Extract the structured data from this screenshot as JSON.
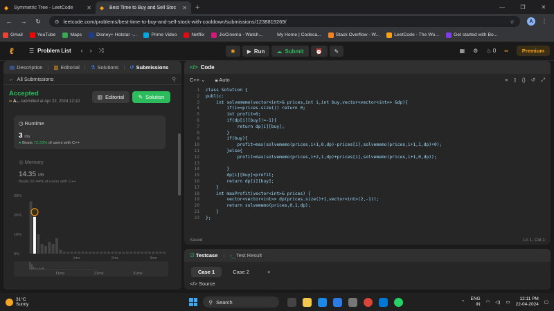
{
  "browser": {
    "tabs": [
      {
        "title": "Symmetric Tree - LeetCode",
        "active": false
      },
      {
        "title": "Best Time to Buy and Sell Stoc",
        "active": true
      }
    ],
    "url": "leetcode.com/problems/best-time-to-buy-and-sell-stock-with-cooldown/submissions/1238819269/",
    "profile_initial": "A",
    "bookmarks": [
      "Gmail",
      "YouTube",
      "Maps",
      "Disney+ Hotstar -...",
      "Prime Video",
      "Netflix",
      "JioCinema - Watch...",
      "My Home | Codeca...",
      "Stack Overflow - W...",
      "LeetCode - The Wo...",
      "Get started with Bo..."
    ]
  },
  "topbar": {
    "problem_list": "Problem List",
    "run": "Run",
    "submit": "Submit",
    "streak": "0",
    "premium": "Premium"
  },
  "left": {
    "tabs": [
      "Description",
      "Editorial",
      "Solutions",
      "Submissions"
    ],
    "all_submissions": "All Submissions",
    "status": "Accepted",
    "user": "A...",
    "submitted": "submitted at Apr 22, 2024 12:10",
    "editorial_btn": "Editorial",
    "solution_btn": "Solution",
    "runtime_label": "Runtime",
    "runtime_value": "3",
    "runtime_unit": "ms",
    "runtime_beats_pre": "Beats",
    "runtime_beats_pct": "72.33%",
    "runtime_beats_post": "of users with C++",
    "memory_label": "Memory",
    "memory_value": "14.35",
    "memory_unit": "MB",
    "memory_beats": "Beats 26.44% of users with C++"
  },
  "chart_data": {
    "type": "bar",
    "y_ticks": [
      "30%",
      "20%",
      "10%",
      "0%"
    ],
    "x_ticks": [
      "1ms",
      "2ms",
      "3ms"
    ],
    "mini_x_ticks": [
      "11ms",
      "21ms",
      "31ms"
    ],
    "ylim": [
      0,
      30
    ],
    "values": [
      27,
      19,
      10,
      5,
      4,
      6,
      5,
      8,
      2,
      1,
      1,
      1,
      1,
      1,
      1,
      1,
      1,
      1,
      1,
      1,
      1,
      1,
      1,
      1,
      1,
      1,
      1,
      1,
      1,
      1,
      1,
      1,
      1,
      1,
      1,
      1,
      1
    ],
    "highlight_index": 1,
    "colors": {
      "bar": "#444444",
      "highlight": "#ffffff"
    }
  },
  "code": {
    "title": "Code",
    "language": "C++",
    "mode": "Auto",
    "lines": [
      "class Solution {",
      "public:",
      "    int solvememo(vector<int>& prices,int i,int buy,vector<vector<int>> &dp){",
      "        if(i>=prices.size()) return 0;",
      "        int profit=0;",
      "        if(dp[i][buy]!=-1){",
      "            return dp[i][buy];",
      "        }",
      "        if(buy){",
      "            profit=max(solvememo(prices,i+1,0,dp)-prices[i],solvememo(prices,i+1,1,dp)+0);",
      "        }else{",
      "            profit=max(solvememo(prices,i+2,1,dp)+prices[i],solvememo(prices,i+1,0,dp));",
      "",
      "        }",
      "        dp[i][buy]=profit;",
      "        return dp[i][buy];",
      "    }",
      "    int maxProfit(vector<int>& prices) {",
      "        vector<vector<int>> dp(prices.size()+1,vector<int>(2,-1));",
      "        return solvememo(prices,0,1,dp);",
      "    }",
      "};"
    ],
    "saved": "Saved",
    "cursor": "Ln 1, Col 1"
  },
  "testcase": {
    "tab_active": "Testcase",
    "tab_other": "Test Result",
    "cases": [
      "Case 1",
      "Case 2"
    ],
    "source": "Source"
  },
  "taskbar": {
    "temp": "31°C",
    "weather": "Sunny",
    "search": "Search",
    "lang1": "ENG",
    "lang2": "IN",
    "time": "12:11 PM",
    "date": "22-04-2024"
  }
}
